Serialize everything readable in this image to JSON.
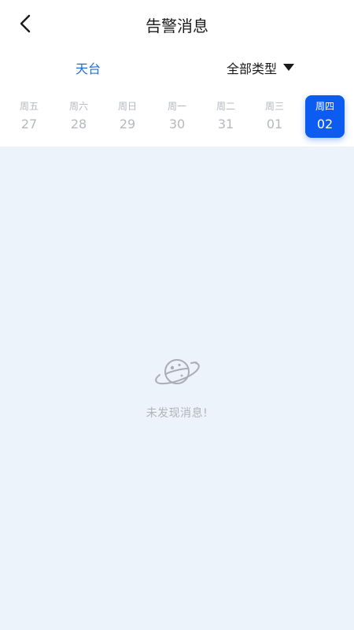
{
  "header": {
    "title": "告警消息",
    "back_icon": "chevron-left-icon"
  },
  "filters": {
    "location": "天台",
    "type_label": "全部类型",
    "type_icon": "triangle-down-icon"
  },
  "dates": [
    {
      "weekday": "周五",
      "day": "27",
      "selected": false
    },
    {
      "weekday": "周六",
      "day": "28",
      "selected": false
    },
    {
      "weekday": "周日",
      "day": "29",
      "selected": false
    },
    {
      "weekday": "周一",
      "day": "30",
      "selected": false
    },
    {
      "weekday": "周二",
      "day": "31",
      "selected": false
    },
    {
      "weekday": "周三",
      "day": "01",
      "selected": false
    },
    {
      "weekday": "周四",
      "day": "02",
      "selected": true
    }
  ],
  "empty": {
    "icon": "planet-icon",
    "message": "未发现消息!"
  },
  "colors": {
    "accent": "#0d5cf2",
    "location_text": "#1e6fd9",
    "content_bg": "#edf3fb",
    "muted_text": "#b5b8bf"
  }
}
